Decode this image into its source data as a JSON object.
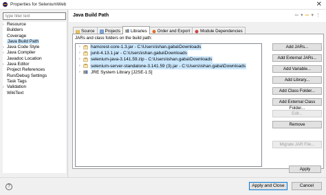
{
  "window": {
    "title": "Properties for SeleniumWeb",
    "close_glyph": "✕"
  },
  "filter": {
    "placeholder": "type filter text"
  },
  "tree": {
    "items": [
      {
        "label": "Resource",
        "expandable": true
      },
      {
        "label": "Builders",
        "expandable": false
      },
      {
        "label": "Coverage",
        "expandable": false
      },
      {
        "label": "Java Build Path",
        "expandable": false,
        "selected": true
      },
      {
        "label": "Java Code Style",
        "expandable": true
      },
      {
        "label": "Java Compiler",
        "expandable": true
      },
      {
        "label": "Javadoc Location",
        "expandable": false
      },
      {
        "label": "Java Editor",
        "expandable": true
      },
      {
        "label": "Project References",
        "expandable": false
      },
      {
        "label": "Run/Debug Settings",
        "expandable": false
      },
      {
        "label": "Task Tags",
        "expandable": false
      },
      {
        "label": "Validation",
        "expandable": true
      },
      {
        "label": "WikiText",
        "expandable": false
      }
    ]
  },
  "page": {
    "title": "Java Build Path"
  },
  "tabs": [
    {
      "label": "Source",
      "icon": "source-folder-icon"
    },
    {
      "label": "Projects",
      "icon": "projects-icon"
    },
    {
      "label": "Libraries",
      "icon": "libraries-icon",
      "active": true
    },
    {
      "label": "Order and Export",
      "icon": "order-export-icon"
    },
    {
      "label": "Module Dependencies",
      "icon": "module-dependencies-icon"
    }
  ],
  "libraries": {
    "label": "JARs and class folders on the build path:",
    "items": [
      {
        "label": "hamcrest-core-1.3.jar - C:\\Users\\ishan.gaba\\Downloads",
        "selected": true
      },
      {
        "label": "junit-4.13.1.jar - C:\\Users\\ishan.gaba\\Downloads",
        "selected": true
      },
      {
        "label": "selenium-java-3.141.59.zip - C:\\Users\\ishan.gaba\\Downloads",
        "selected": true
      },
      {
        "label": "selenium-server-standalone-3.141.59 (3).jar - C:\\Users\\ishan.gaba\\Downloads",
        "selected": true
      },
      {
        "label": "JRE System Library [J2SE-1.5]",
        "selected": false
      }
    ]
  },
  "buttons": {
    "add_jars": "Add JARs...",
    "add_external_jars": "Add External JARs...",
    "add_variable": "Add Variable...",
    "add_library": "Add Library...",
    "add_class_folder": "Add Class Folder...",
    "add_external_class_folder": "Add External Class Folder...",
    "edit": "Edit...",
    "remove": "Remove",
    "migrate_jar": "Migrate JAR File...",
    "apply": "Apply",
    "apply_and_close": "Apply and Close",
    "cancel": "Cancel"
  },
  "colors": {
    "selection": "#cce8ff",
    "primary_border": "#0078d7"
  }
}
